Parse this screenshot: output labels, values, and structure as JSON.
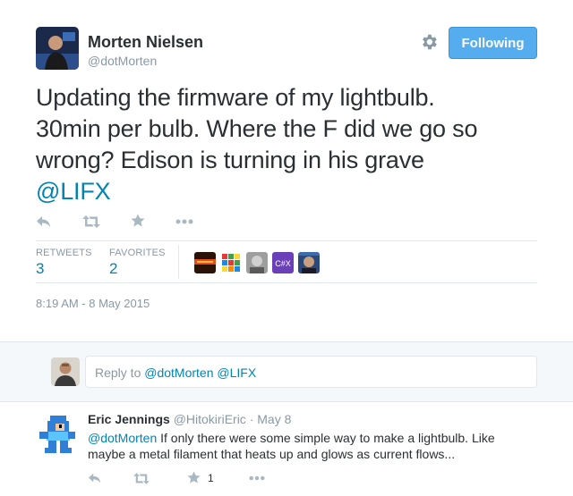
{
  "tweet": {
    "author_name": "Morten Nielsen",
    "author_handle": "@dotMorten",
    "follow_label": "Following",
    "text_line1": "Updating the firmware of my lightbulb.",
    "text_line2": "30min per bulb. Where the F did we go so",
    "text_line3": "wrong? Edison is turning in his grave",
    "mention": "@LIFX",
    "stats": {
      "retweets_label": "RETWEETS",
      "retweets_value": "3",
      "favorites_label": "FAVORITES",
      "favorites_value": "2"
    },
    "timestamp": "8:19 AM - 8 May 2015",
    "favoriter_avatar_texts": [
      "C#X"
    ]
  },
  "reply_box": {
    "prefix": "Reply to ",
    "mentions": "@dotMorten @LIFX"
  },
  "reply_tweet": {
    "author_name": "Eric Jennings",
    "meta": "@HitokiriEric · May 8",
    "mention": "@dotMorten",
    "text_rest": " If only there were some simple way to make a lightbulb. Like maybe a metal filament that heats up and glows as current flows...",
    "favorite_count": "1"
  },
  "colors": {
    "accent": "#55acee",
    "link": "#0084b4",
    "muted": "#8899a6",
    "icon": "#aab8c2",
    "reply_bg": "#f5f8fa"
  },
  "icons": [
    "gear-icon",
    "reply-icon",
    "retweet-icon",
    "favorite-icon",
    "more-icon"
  ]
}
